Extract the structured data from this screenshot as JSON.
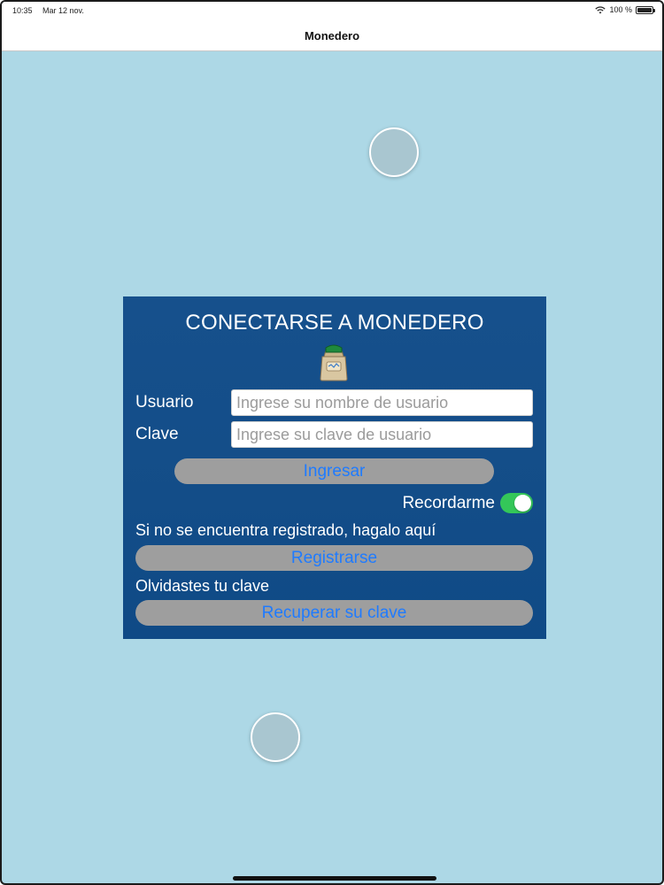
{
  "status_bar": {
    "time": "10:35",
    "date": "Mar 12 nov.",
    "battery": "100 %"
  },
  "nav": {
    "title": "Monedero"
  },
  "login": {
    "title": "CONECTARSE A MONEDERO",
    "user_label": "Usuario",
    "user_placeholder": "Ingrese su nombre de usuario",
    "user_value": "",
    "password_label": "Clave",
    "password_placeholder": "Ingrese su clave de usuario",
    "password_value": "",
    "login_button": "Ingresar",
    "remember_label": "Recordarme",
    "remember_on": true,
    "not_registered_text": "Si no se encuentra registrado, hagalo aquí",
    "register_button": "Registrarse",
    "forgot_text": "Olvidastes tu clave",
    "recover_button": "Recuperar su clave"
  },
  "icons": {
    "wallet": "wallet-icon",
    "wifi": "wifi-icon",
    "battery": "battery-icon"
  },
  "colors": {
    "background": "#add8e6",
    "card": "#134d88",
    "button": "#9e9e9e",
    "button_text": "#1f7bff",
    "toggle_on": "#34c759"
  }
}
